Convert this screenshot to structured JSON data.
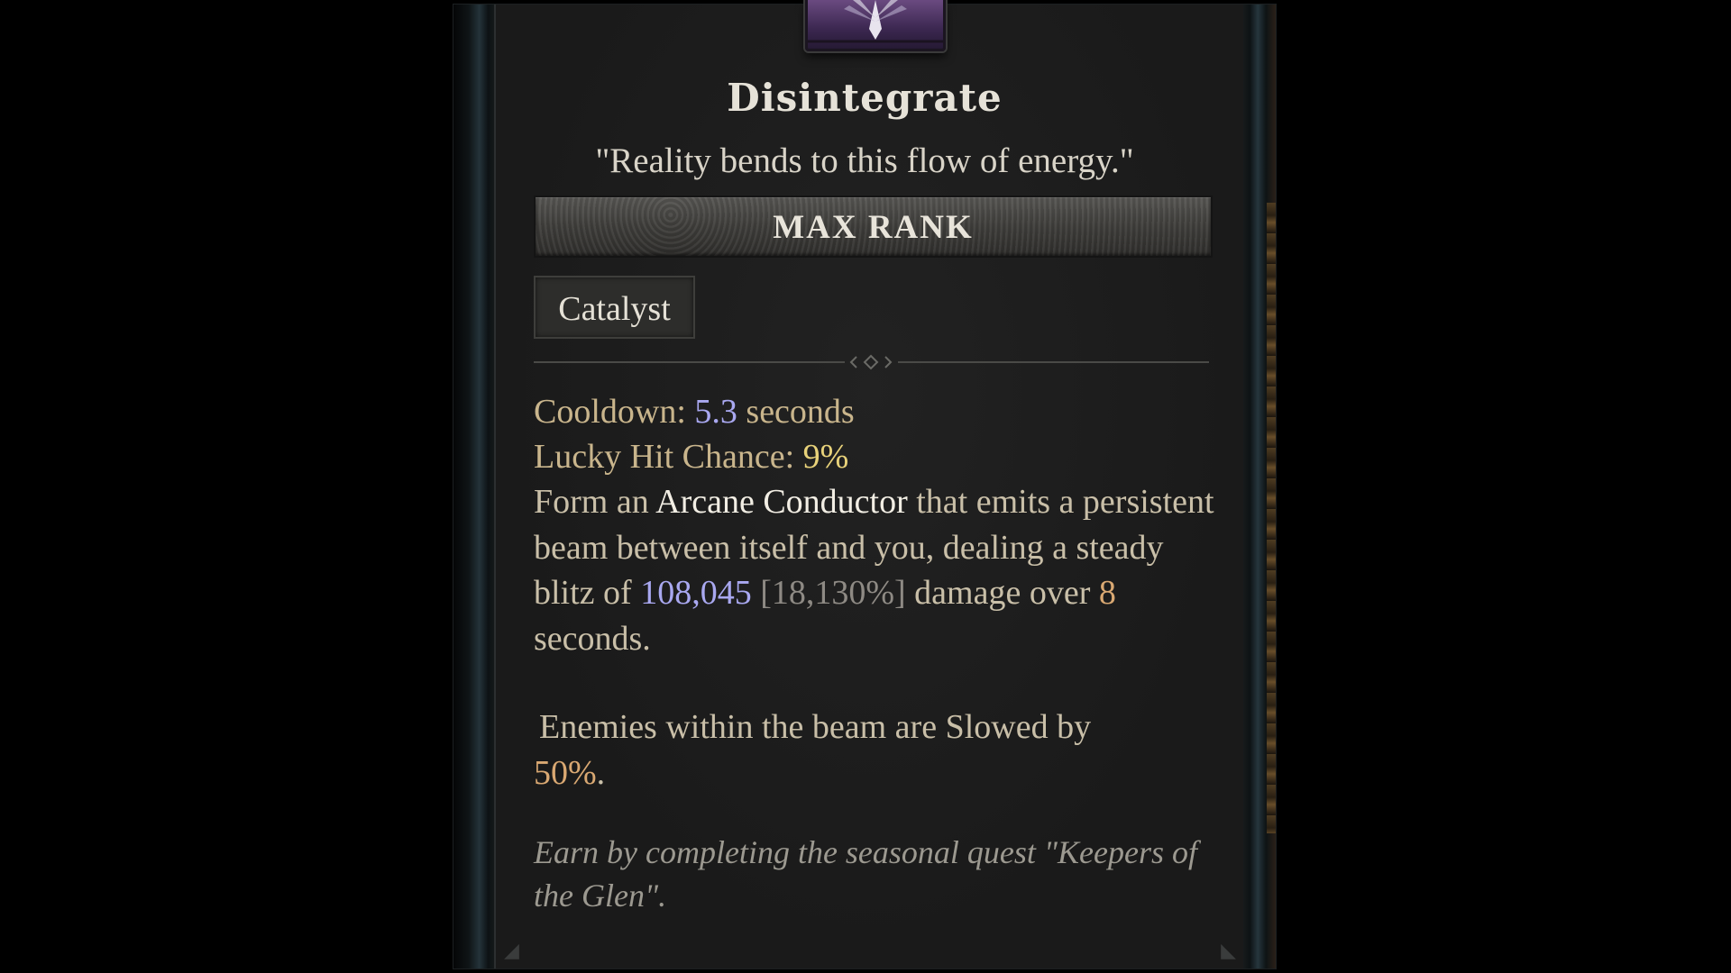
{
  "colors": {
    "background": "#000000",
    "panel": "#1a1a1a",
    "title": "#e6e2d8",
    "stat_label": "#c9b58c",
    "value_blue": "#a9a8f0",
    "value_gold": "#e8d27a",
    "value_orange": "#d9a872",
    "bracket_gray": "#8e8a84",
    "note_gray": "#9c9990"
  },
  "skill": {
    "icon": "disintegrate-skill-icon",
    "name": "Disintegrate",
    "flavor": "\"Reality bends to this flow of energy.\"",
    "rank": "MAX RANK",
    "tag": "Catalyst"
  },
  "stats": {
    "cooldown_label": "Cooldown:",
    "cooldown_value": "5.3",
    "cooldown_unit": "seconds",
    "lucky_label": "Lucky Hit Chance:",
    "lucky_value": "9%"
  },
  "description": {
    "p1_a": "Form an ",
    "p1_keyword": "Arcane Conductor",
    "p1_b": " that emits a persistent beam between itself and you, dealing a steady blitz of ",
    "damage_value": "108,045",
    "damage_percent": "[18,130%]",
    "p1_c": "damage over ",
    "duration": "8",
    "p1_d": " seconds.",
    "p2_a": "Enemies within the beam are Slowed by ",
    "slow_value": "50%",
    "p2_b": "."
  },
  "note": "Earn by completing the seasonal quest \"Keepers of the Glen\"."
}
